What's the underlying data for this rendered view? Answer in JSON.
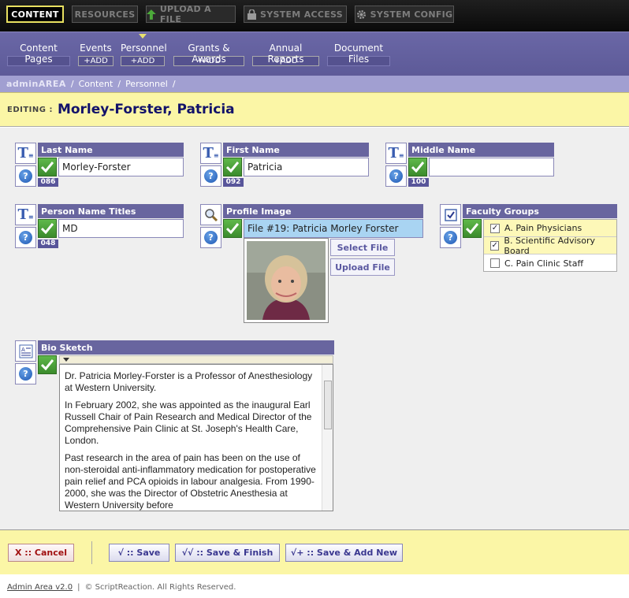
{
  "topnav": {
    "content": "CONTENT",
    "resources": "RESOURCES",
    "upload": "UPLOAD A FILE",
    "access": "SYSTEM ACCESS",
    "config": "SYSTEM CONFIG"
  },
  "subnav": [
    {
      "label": "Content Pages",
      "add": "- - -"
    },
    {
      "label": "Events",
      "add": "+ADD"
    },
    {
      "label": "Personnel",
      "add": "+ADD"
    },
    {
      "label": "Grants & Awards",
      "add": "+ADD"
    },
    {
      "label": "Annual Reports",
      "add": "+ADD"
    },
    {
      "label": "Document Files",
      "add": "- - -"
    }
  ],
  "breadcrumb": {
    "admin": "adminAREA",
    "sep": "/",
    "items": [
      "Content",
      "Personnel"
    ]
  },
  "edit": {
    "prefix": "EDITING :",
    "name": "Morley-Forster, Patricia"
  },
  "fields": {
    "last_name": {
      "label": "Last Name",
      "value": "Morley-Forster",
      "counter": "086"
    },
    "first_name": {
      "label": "First Name",
      "value": "Patricia",
      "counter": "092"
    },
    "middle_name": {
      "label": "Middle Name",
      "value": "",
      "counter": "100"
    },
    "titles": {
      "label": "Person Name Titles",
      "value": "MD",
      "counter": "048"
    },
    "profile_image": {
      "label": "Profile Image",
      "value": "File #19: Patricia Morley Forster",
      "select": "Select File",
      "upload": "Upload File"
    },
    "faculty_groups": {
      "label": "Faculty Groups",
      "options": [
        {
          "label": "A. Pain Physicians",
          "checked": true
        },
        {
          "label": "B. Scientific Advisory Board",
          "checked": true
        },
        {
          "label": "C. Pain Clinic Staff",
          "checked": false
        }
      ]
    },
    "bio": {
      "label": "Bio Sketch",
      "paragraphs": [
        "Dr. Patricia Morley-Forster is a Professor of Anesthesiology at Western University.",
        "In February 2002, she was appointed as the inaugural Earl Russell Chair of Pain Research and Medical Director of the Comprehensive Pain Clinic at St. Joseph's Health Care, London.",
        "Past research in the area of pain has been on the use of non-steroidal anti-inflammatory medication for postoperative pain relief and PCA opioids in labour analgesia. From 1990-2000, she was the Director of Obstetric Anesthesia at Western University before"
      ]
    }
  },
  "footer": {
    "cancel": "X :: Cancel",
    "save": "√ :: Save",
    "save_finish": "√√ :: Save & Finish",
    "save_add": "√+ :: Save & Add New"
  },
  "copyright": {
    "link": "Admin Area v2.0",
    "sep": "|",
    "text": "© ScriptReaction. All Rights Reserved."
  },
  "colors": {
    "accent": "#68659f",
    "highlight": "#fbf6a6",
    "check": "#4ca23a"
  }
}
